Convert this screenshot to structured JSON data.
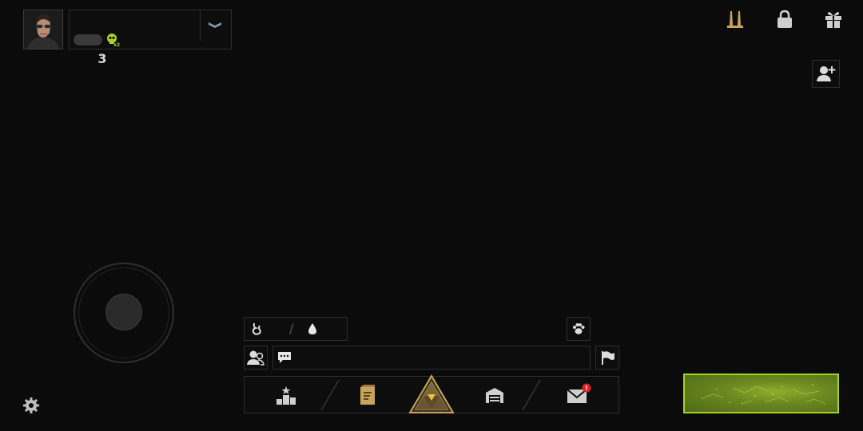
{
  "profile": {
    "avatar_icon": "survivor-portrait",
    "rank_icon": "rank-chevron-icon",
    "level_icon": "skull-badge-icon",
    "rank_glyph": "3"
  },
  "top_right": {
    "icons": [
      "tower-icon",
      "lock-icon",
      "gift-icon"
    ],
    "add_friend_icon": "add-friend-icon"
  },
  "status": {
    "hunger_icon": "stomach-icon",
    "separator": "/",
    "water_icon": "water-drop-icon",
    "pet_icon": "paw-icon"
  },
  "chat": {
    "party_icon": "party-icon",
    "chat_icon": "chat-bubble-icon",
    "flag_icon": "flag-icon"
  },
  "bottom_nav": {
    "items": [
      {
        "name": "ranking",
        "icon": "podium-icon"
      },
      {
        "name": "crafting",
        "icon": "blueprint-icon"
      },
      {
        "name": "center",
        "icon": "triangle-emblem-icon"
      },
      {
        "name": "base",
        "icon": "garage-icon"
      },
      {
        "name": "mail",
        "icon": "mail-icon",
        "alert": "!"
      }
    ]
  },
  "colors": {
    "accent_green": "#a6d322",
    "gold": "#c8a35a",
    "alert_red": "#e02020",
    "icon_gray": "#cfcfcf"
  }
}
